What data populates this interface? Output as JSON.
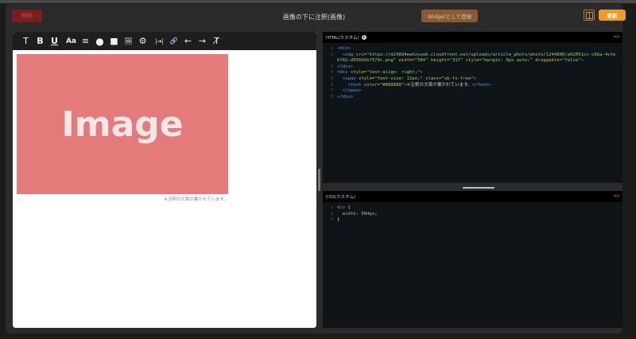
{
  "header": {
    "delete_label": "削除",
    "title": "画像の下に注釈(画像)",
    "widget_label": "Widgetとして登録",
    "update_label": "更新"
  },
  "toolbar": {
    "tools": [
      {
        "name": "text-style-icon",
        "glyph": "T"
      },
      {
        "name": "bold-icon",
        "glyph": "B"
      },
      {
        "name": "underline-icon",
        "glyph": "U"
      },
      {
        "name": "font-size-icon",
        "glyph": "Aa"
      },
      {
        "name": "align-icon",
        "glyph": "≡"
      },
      {
        "name": "color-circle-icon",
        "glyph": "●"
      },
      {
        "name": "background-square-icon",
        "glyph": "■"
      },
      {
        "name": "image-icon",
        "glyph": "🖼"
      },
      {
        "name": "settings-icon",
        "glyph": "⚙"
      },
      {
        "name": "width-icon",
        "glyph": "|⇥|"
      },
      {
        "name": "link-icon",
        "glyph": "🔗"
      },
      {
        "name": "undo-icon",
        "glyph": "←"
      },
      {
        "name": "redo-icon",
        "glyph": "→"
      },
      {
        "name": "clear-format-icon",
        "glyph": "T̸"
      }
    ]
  },
  "canvas": {
    "image_text": "Image",
    "caption": "※注釈の文章が書かれています。"
  },
  "html_pane": {
    "label": "HTML(カスタム)",
    "lines": [
      {
        "n": "1",
        "html": "<span class=\"tag\">&lt;div&gt;</span>"
      },
      {
        "n": "2",
        "html": "  <span class=\"tag\">&lt;img</span> <span class=\"attr\">src=</span><span class=\"str\">\"https://d24894ewhzyuok.cloudfront.net/uploads/article_photo/photo/1244800/a02051cc-c66a-4cfe</span>"
      },
      {
        "n": "",
        "html": "<span class=\"str\">b762-d956d2bf579c.png\"</span> <span class=\"attr\">width=</span><span class=\"str\">\"584\"</span> <span class=\"attr\">height=</span><span class=\"str\">\"317\"</span> <span class=\"attr\">style=</span><span class=\"str\">\"margin: 0px auto;\"</span> <span class=\"attr\">draggable=</span><span class=\"str\">\"false\"</span><span class=\"tag\">&gt;</span>"
      },
      {
        "n": "3",
        "html": "<span class=\"tag\">&lt;/div&gt;</span>"
      },
      {
        "n": "4",
        "html": "<span class=\"tag\">&lt;div</span> <span class=\"attr\">style=</span><span class=\"str\">\"text-align: right;\"</span><span class=\"tag\">&gt;</span>"
      },
      {
        "n": "5",
        "html": "  <span class=\"tag\">&lt;span</span> <span class=\"attr\">style=</span><span class=\"str\">\"font-size: 12px;\"</span> <span class=\"attr\">class=</span><span class=\"str\">\"sb-fs-free\"</span><span class=\"tag\">&gt;</span>"
      },
      {
        "n": "6",
        "html": "    <span class=\"tag\">&lt;font</span> <span class=\"attr\">color=</span><span class=\"str\">\"#888888\"</span><span class=\"tag\">&gt;</span>※注釈の文章が書かれています。<span class=\"tag\">&lt;/font&gt;</span>"
      },
      {
        "n": "7",
        "html": "  <span class=\"tag\">&lt;/span&gt;</span>"
      },
      {
        "n": "8",
        "html": "<span class=\"tag\">&lt;/div&gt;</span>"
      }
    ]
  },
  "css_pane": {
    "label": "CSS(カスタム)",
    "lines": [
      {
        "n": "1",
        "html": "<span class=\"tag\">div</span> {"
      },
      {
        "n": "2",
        "html": "  <span class=\"attr\">width</span>: <span class=\"str\">584px</span>;"
      },
      {
        "n": "3",
        "html": "}"
      }
    ]
  },
  "colors": {
    "accent": "#f09a2a",
    "delete": "#7a1f1f",
    "image_placeholder": "#e47a7a"
  }
}
